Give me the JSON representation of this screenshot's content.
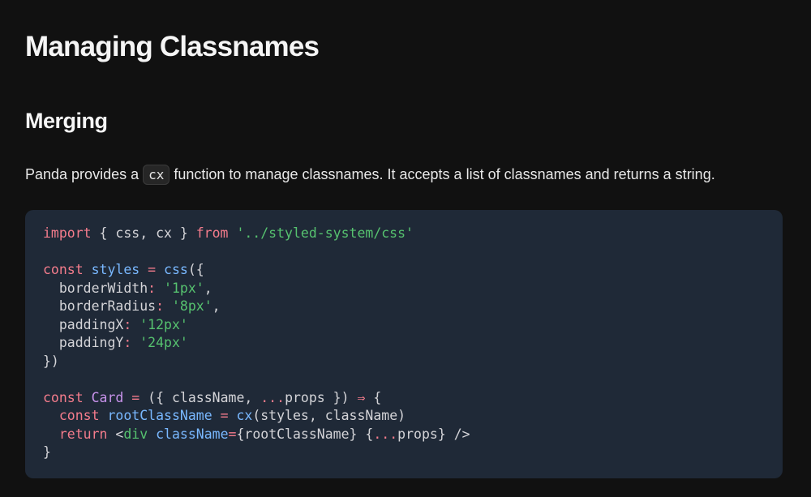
{
  "heading": "Managing Classnames",
  "subheading": "Merging",
  "intro": {
    "before": "Panda provides a ",
    "code": "cx",
    "after": " function to manage classnames. It accepts a list of classnames and returns a string."
  },
  "code": {
    "colors": {
      "keyword": "#f47c8c",
      "identifier": "#79b8ff",
      "string": "#56c26f",
      "component": "#c792ea",
      "plain": "#d4d4d8",
      "background": "#1f2937"
    },
    "lines": [
      [
        {
          "t": "import",
          "c": "kw"
        },
        {
          "t": " { css, cx } ",
          "c": "pl"
        },
        {
          "t": "from",
          "c": "kw"
        },
        {
          "t": " ",
          "c": "pl"
        },
        {
          "t": "'../styled-system/css'",
          "c": "st"
        }
      ],
      [],
      [
        {
          "t": "const",
          "c": "kw"
        },
        {
          "t": " ",
          "c": "pl"
        },
        {
          "t": "styles",
          "c": "fn"
        },
        {
          "t": " ",
          "c": "pl"
        },
        {
          "t": "=",
          "c": "kw"
        },
        {
          "t": " ",
          "c": "pl"
        },
        {
          "t": "css",
          "c": "fn"
        },
        {
          "t": "({",
          "c": "pl"
        }
      ],
      [
        {
          "t": "  borderWidth",
          "c": "pl"
        },
        {
          "t": ":",
          "c": "kw"
        },
        {
          "t": " ",
          "c": "pl"
        },
        {
          "t": "'1px'",
          "c": "st"
        },
        {
          "t": ",",
          "c": "pl"
        }
      ],
      [
        {
          "t": "  borderRadius",
          "c": "pl"
        },
        {
          "t": ":",
          "c": "kw"
        },
        {
          "t": " ",
          "c": "pl"
        },
        {
          "t": "'8px'",
          "c": "st"
        },
        {
          "t": ",",
          "c": "pl"
        }
      ],
      [
        {
          "t": "  paddingX",
          "c": "pl"
        },
        {
          "t": ":",
          "c": "kw"
        },
        {
          "t": " ",
          "c": "pl"
        },
        {
          "t": "'12px'",
          "c": "st"
        }
      ],
      [
        {
          "t": "  paddingY",
          "c": "pl"
        },
        {
          "t": ":",
          "c": "kw"
        },
        {
          "t": " ",
          "c": "pl"
        },
        {
          "t": "'24px'",
          "c": "st"
        }
      ],
      [
        {
          "t": "})",
          "c": "pl"
        }
      ],
      [],
      [
        {
          "t": "const",
          "c": "kw"
        },
        {
          "t": " ",
          "c": "pl"
        },
        {
          "t": "Card",
          "c": "cm"
        },
        {
          "t": " ",
          "c": "pl"
        },
        {
          "t": "=",
          "c": "kw"
        },
        {
          "t": " ({ className, ",
          "c": "pl"
        },
        {
          "t": "...",
          "c": "kw"
        },
        {
          "t": "props }) ",
          "c": "pl"
        },
        {
          "t": "⇒",
          "c": "kw"
        },
        {
          "t": " {",
          "c": "pl"
        }
      ],
      [
        {
          "t": "  ",
          "c": "pl"
        },
        {
          "t": "const",
          "c": "kw"
        },
        {
          "t": " ",
          "c": "pl"
        },
        {
          "t": "rootClassName",
          "c": "fn"
        },
        {
          "t": " ",
          "c": "pl"
        },
        {
          "t": "=",
          "c": "kw"
        },
        {
          "t": " ",
          "c": "pl"
        },
        {
          "t": "cx",
          "c": "fn"
        },
        {
          "t": "(styles, className)",
          "c": "pl"
        }
      ],
      [
        {
          "t": "  ",
          "c": "pl"
        },
        {
          "t": "return",
          "c": "kw"
        },
        {
          "t": " <",
          "c": "pl"
        },
        {
          "t": "div",
          "c": "st"
        },
        {
          "t": " ",
          "c": "pl"
        },
        {
          "t": "className",
          "c": "fn"
        },
        {
          "t": "=",
          "c": "kw"
        },
        {
          "t": "{rootClassName} {",
          "c": "pl"
        },
        {
          "t": "...",
          "c": "kw"
        },
        {
          "t": "props} />",
          "c": "pl"
        }
      ],
      [
        {
          "t": "}",
          "c": "pl"
        }
      ]
    ]
  }
}
